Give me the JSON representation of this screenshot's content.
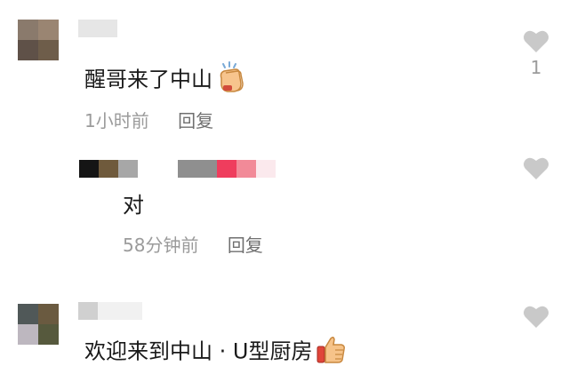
{
  "comments": [
    {
      "text": "醒哥来了中山",
      "time": "1小时前",
      "reply_label": "回复",
      "like_count": "1",
      "emoji_icon": "clapping-hands-icon"
    },
    {
      "text": "对",
      "time": "58分钟前",
      "reply_label": "回复",
      "like_count": ""
    },
    {
      "text": "欢迎来到中山 · U型厨房",
      "emoji_icon": "thumbs-up-icon"
    }
  ],
  "colors": {
    "meta_text": "#9b9b9b",
    "reply_text": "#6f6f6f",
    "like_icon": "#c9c9c9"
  }
}
